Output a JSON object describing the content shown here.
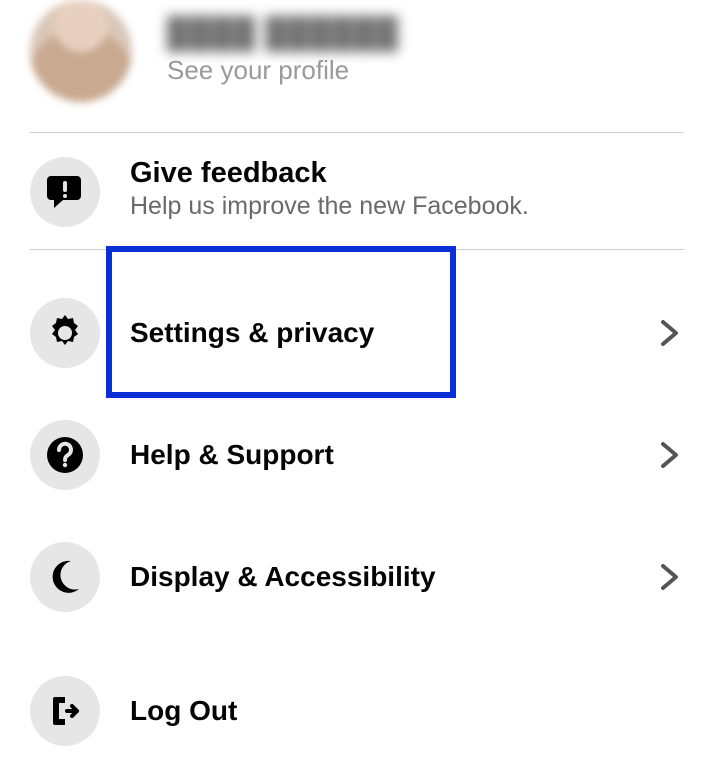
{
  "profile": {
    "name_blurred": "████ ██████",
    "subtitle": "See your profile"
  },
  "feedback": {
    "title": "Give feedback",
    "subtitle": "Help us improve the new Facebook."
  },
  "menu": {
    "settings": {
      "label": "Settings & privacy"
    },
    "help": {
      "label": "Help & Support"
    },
    "display": {
      "label": "Display & Accessibility"
    },
    "logout": {
      "label": "Log Out"
    }
  },
  "highlight": {
    "target": "settings"
  }
}
